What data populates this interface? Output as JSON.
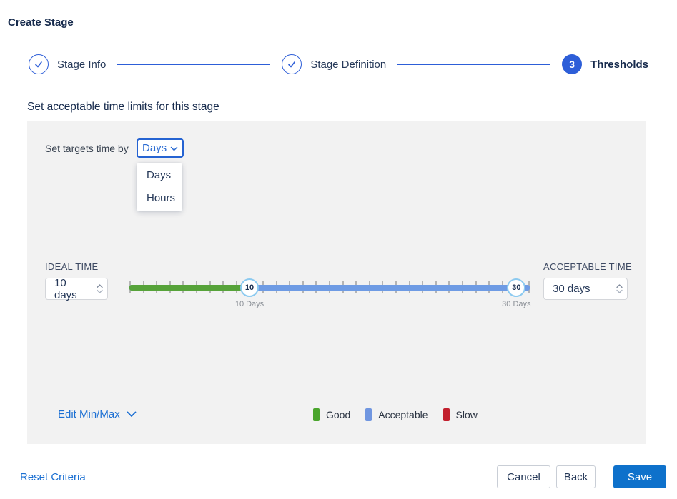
{
  "page": {
    "title": "Create Stage"
  },
  "stepper": {
    "steps": [
      {
        "label": "Stage Info",
        "state": "complete"
      },
      {
        "label": "Stage Definition",
        "state": "complete"
      },
      {
        "label": "Thresholds",
        "state": "current",
        "number": "3"
      }
    ]
  },
  "section": {
    "heading": "Set acceptable time limits for this stage"
  },
  "targets": {
    "label": "Set targets time by",
    "selected": "Days",
    "options": [
      "Days",
      "Hours"
    ]
  },
  "slider": {
    "ideal": {
      "label": "IDEAL TIME",
      "value": "10 days",
      "handle": "10",
      "handle_label": "10 Days"
    },
    "acceptable": {
      "label": "ACCEPTABLE TIME",
      "value": "30 days",
      "handle": "30",
      "handle_label": "30 Days"
    }
  },
  "legend": {
    "items": [
      {
        "label": "Good",
        "color": "#4aa52c"
      },
      {
        "label": "Acceptable",
        "color": "#7096e0"
      },
      {
        "label": "Slow",
        "color": "#c2202e"
      }
    ]
  },
  "edit_minmax": {
    "label": "Edit Min/Max"
  },
  "footer": {
    "reset": "Reset Criteria",
    "cancel": "Cancel",
    "back": "Back",
    "save": "Save"
  },
  "colors": {
    "accent_blue": "#2d5ed8",
    "link_blue": "#1b6fd3",
    "save_blue": "#0e71cb",
    "track_good": "#57a33a",
    "track_acceptable": "#6e9be4",
    "panel_bg": "#f2f2f2"
  }
}
